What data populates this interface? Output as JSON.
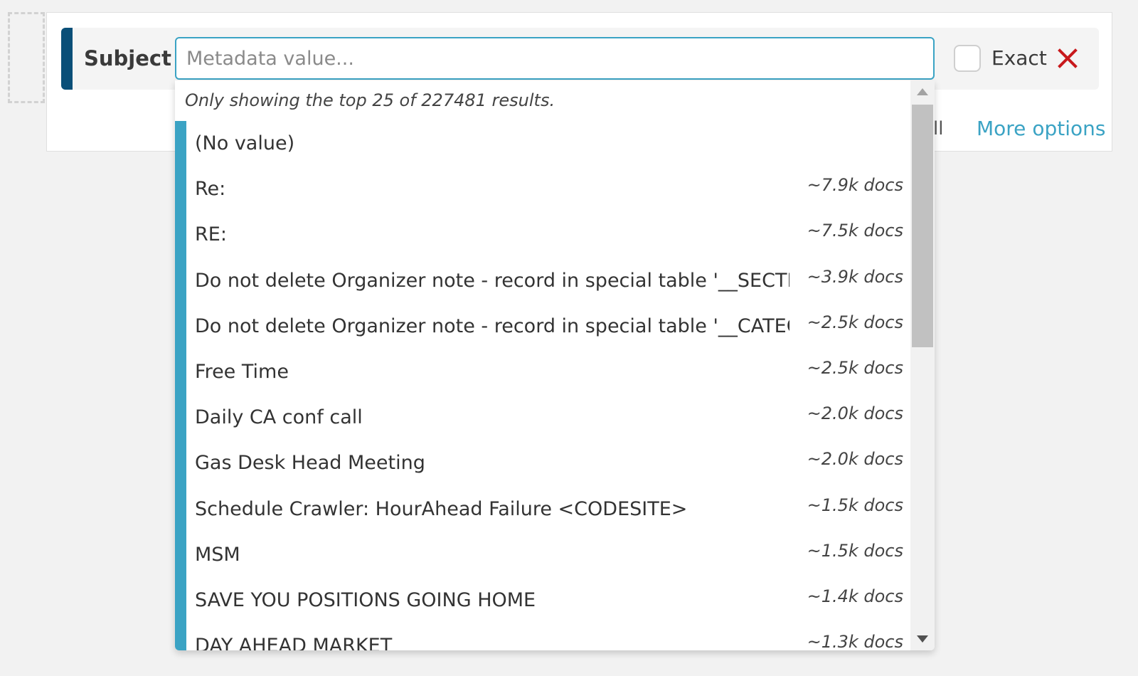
{
  "filter": {
    "field_label": "Subject",
    "input_placeholder": "Metadata value...",
    "input_value": "",
    "exact_label": "Exact",
    "exact_checked": false,
    "more_options_label": "More options",
    "hidden_action_fragment": "ll"
  },
  "dropdown": {
    "note": "Only showing the top 25 of 227481 results.",
    "options": [
      {
        "label": "(No value)",
        "count": ""
      },
      {
        "label": "Re:",
        "count": "~7.9k docs"
      },
      {
        "label": "RE:",
        "count": "~7.5k docs"
      },
      {
        "label": "Do not delete Organizer note - record in special table '__SECTION",
        "count": "~3.9k docs"
      },
      {
        "label": "Do not delete Organizer note - record in special table '__CATEGC",
        "count": "~2.5k docs"
      },
      {
        "label": "Free Time",
        "count": "~2.5k docs"
      },
      {
        "label": "Daily CA conf call",
        "count": "~2.0k docs"
      },
      {
        "label": "Gas Desk Head Meeting",
        "count": "~2.0k docs"
      },
      {
        "label": "Schedule Crawler: HourAhead Failure <CODESITE>",
        "count": "~1.5k docs"
      },
      {
        "label": "MSM",
        "count": "~1.5k docs"
      },
      {
        "label": "SAVE YOU POSITIONS GOING HOME",
        "count": "~1.4k docs"
      },
      {
        "label": "DAY AHEAD MARKET",
        "count": "~1.3k docs"
      }
    ]
  },
  "colors": {
    "accent_dark": "#0a4f78",
    "accent_light": "#3ba3c4",
    "remove": "#c8191c"
  },
  "icons": {
    "remove": "close-icon",
    "scroll_up": "caret-up-icon",
    "scroll_down": "caret-down-icon"
  }
}
